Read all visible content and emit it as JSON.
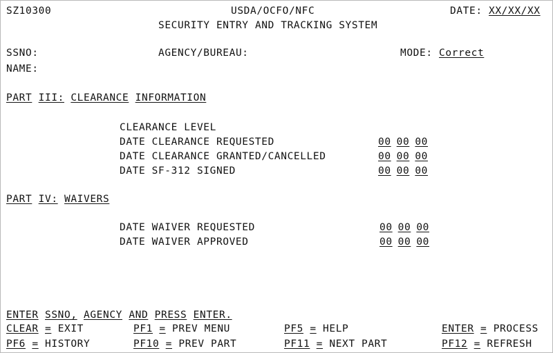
{
  "header": {
    "screen_id": "SZ10300",
    "organization": "USDA/OCFO/NFC",
    "system_title": "SECURITY ENTRY AND TRACKING SYSTEM",
    "date_label": "DATE:",
    "date_value": "XX/XX/XX"
  },
  "identity": {
    "ssno_label": "SSNO:",
    "ssno_value": "",
    "name_label": "NAME:",
    "name_value": "",
    "agency_label": "AGENCY/BUREAU:",
    "agency_value": "",
    "mode_label": "MODE:",
    "mode_value": "Correct"
  },
  "part3": {
    "heading_word1": "PART",
    "heading_word2": "III:",
    "heading_word3": "CLEARANCE",
    "heading_word4": "INFORMATION",
    "fields": [
      {
        "label": "CLEARANCE LEVEL",
        "value": "",
        "has_date": false
      },
      {
        "label": "DATE CLEARANCE REQUESTED",
        "mm": "00",
        "dd": "00",
        "yy": "00",
        "has_date": true
      },
      {
        "label": "DATE CLEARANCE GRANTED/CANCELLED",
        "mm": "00",
        "dd": "00",
        "yy": "00",
        "has_date": true
      },
      {
        "label": "DATE SF-312 SIGNED",
        "mm": "00",
        "dd": "00",
        "yy": "00",
        "has_date": true
      }
    ]
  },
  "part4": {
    "heading_word1": "PART",
    "heading_word2": "IV:",
    "heading_word3": "WAIVERS",
    "fields": [
      {
        "label": "DATE WAIVER REQUESTED",
        "mm": "00",
        "dd": "00",
        "yy": "00"
      },
      {
        "label": "DATE WAIVER APPROVED",
        "mm": "00",
        "dd": "00",
        "yy": "00"
      }
    ]
  },
  "prompt": {
    "w1": "ENTER",
    "w2": "SSNO,",
    "w3": "AGENCY",
    "w4": "AND",
    "w5": "PRESS",
    "w6": "ENTER."
  },
  "function_keys": [
    {
      "key": "CLEAR",
      "sep": "=",
      "action": "EXIT",
      "row": 1,
      "col": 1
    },
    {
      "key": "PF1",
      "sep": "=",
      "action": "PREV MENU",
      "row": 1,
      "col": 2
    },
    {
      "key": "PF5",
      "sep": "=",
      "action": "HELP",
      "row": 1,
      "col": 3
    },
    {
      "key": "ENTER",
      "sep": "=",
      "action": "PROCESS",
      "row": 1,
      "col": 4
    },
    {
      "key": "PF6",
      "sep": "=",
      "action": "HISTORY",
      "row": 2,
      "col": 1
    },
    {
      "key": "PF10",
      "sep": "=",
      "action": "PREV PART",
      "row": 2,
      "col": 2
    },
    {
      "key": "PF11",
      "sep": "=",
      "action": "NEXT PART",
      "row": 2,
      "col": 3
    },
    {
      "key": "PF12",
      "sep": "=",
      "action": "REFRESH",
      "row": 2,
      "col": 4
    }
  ],
  "colors": {
    "text": "#111111",
    "background": "#ffffff",
    "border": "#b9b9b9"
  }
}
